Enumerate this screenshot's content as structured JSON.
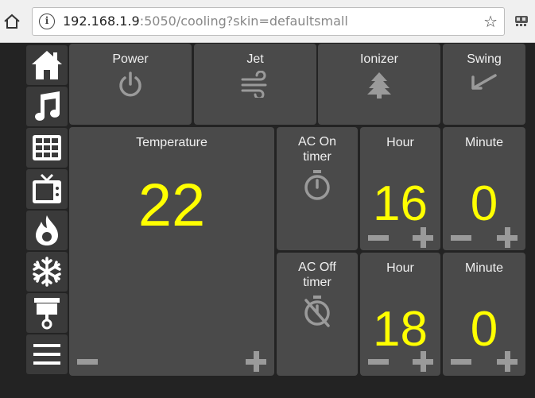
{
  "browser": {
    "url_host": "192.168.1.9",
    "url_rest": ":5050/cooling?skin=defaultsmall",
    "info_glyph": "i",
    "star_glyph": "☆",
    "home_glyph": "⌂"
  },
  "sidebar": {
    "items": [
      {
        "icon": "home-icon"
      },
      {
        "icon": "music-icon"
      },
      {
        "icon": "grid-icon"
      },
      {
        "icon": "tv-icon"
      },
      {
        "icon": "fire-icon"
      },
      {
        "icon": "snowflake-icon"
      },
      {
        "icon": "cooling-unit-icon"
      },
      {
        "icon": "menu-icon"
      }
    ]
  },
  "top_controls": [
    {
      "label": "Power",
      "icon": "power-icon"
    },
    {
      "label": "Jet",
      "icon": "wind-icon"
    },
    {
      "label": "Ionizer",
      "icon": "tree-icon"
    },
    {
      "label": "Swing",
      "icon": "swing-icon"
    }
  ],
  "temperature": {
    "label": "Temperature",
    "value": "22"
  },
  "on_timer": {
    "label_line1": "AC On",
    "label_line2": "timer",
    "hour_label": "Hour",
    "hour": "16",
    "minute_label": "Minute",
    "minute": "0"
  },
  "off_timer": {
    "label_line1": "AC Off",
    "label_line2": "timer",
    "hour_label": "Hour",
    "hour": "18",
    "minute_label": "Minute",
    "minute": "0"
  },
  "colors": {
    "value": "#ffff00",
    "tile": "#4a4a4a",
    "background": "#232323",
    "icon": "#9a9a9a"
  }
}
